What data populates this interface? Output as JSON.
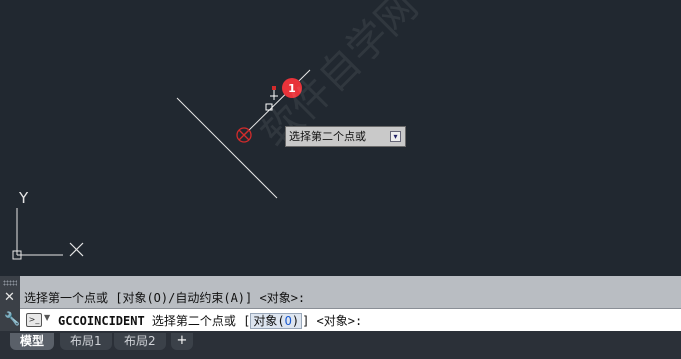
{
  "canvas": {
    "tooltip_text": "选择第二个点或",
    "badge_number": "1",
    "ucs_y_label": "Y",
    "watermark": "软件自学网 RJZXW.COM"
  },
  "command": {
    "history": "选择第一个点或 [对象(O)/自动约束(A)] <对象>:",
    "cmd_name": "GCCOINCIDENT",
    "prompt_text": " 选择第二个点或 [",
    "option_label": "对象(",
    "option_key": "O",
    "option_close": ")",
    "prompt_tail": "] <对象>:"
  },
  "tabs": [
    {
      "label": "模型",
      "active": true
    },
    {
      "label": "布局1",
      "active": false
    },
    {
      "label": "布局2",
      "active": false
    }
  ],
  "add_tab_label": "+",
  "colors": {
    "canvas_bg": "#212830",
    "badge_red": "#e8333a",
    "marker_red": "#d22b2b",
    "accent_blue": "#1a5ad0"
  }
}
